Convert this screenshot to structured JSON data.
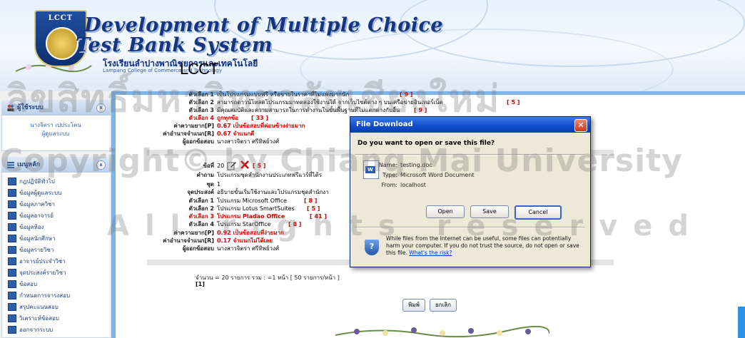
{
  "banner": {
    "logo_text": "LCCT",
    "title_line1": "Development of Multiple Choice",
    "title_line2": "Test Bank System",
    "college_thai": "โรงเรียนลำปางพาณิชยการและเทคโนโลยี",
    "college_english": "Lampang College of Commerce and Technology",
    "college_abbr": "LCCT"
  },
  "sidebar": {
    "user_panel": {
      "title": "ผู้ใช้ระบบ",
      "user_name": "นางจิตรา เปประโคน",
      "user_role": "ผู้ดูแลระบบ"
    },
    "menu_panel": {
      "title": "เมนูหลัก",
      "items": [
        {
          "label": "กฎปฏิบัติทั่วไป"
        },
        {
          "label": "ข้อมูลผู้ดูแลระบบ"
        },
        {
          "label": "ข้อมูลภาควิชา"
        },
        {
          "label": "ข้อมูลอาจารย์"
        },
        {
          "label": "ข้อมูลห้อง"
        },
        {
          "label": "ข้อมูลนักศึกษา"
        },
        {
          "label": "ข้อมูลรายวิชา"
        },
        {
          "label": "อาจารย์ประจำวิชา"
        },
        {
          "label": "จุดประสงค์รายวิชา"
        },
        {
          "label": "ข้อสอบ"
        },
        {
          "label": "กำหนดการจารงสอบ"
        },
        {
          "label": "สรุปคะแนนสอบ"
        },
        {
          "label": "วิเคราะห์ข้อสอบ"
        },
        {
          "label": "ออกจากระบบ"
        }
      ]
    }
  },
  "question19": {
    "rows": [
      {
        "label": "ตัวเลือก 1",
        "value": "เป็นโปรแกรมแบบฟรี หรือขายในราคาที่ไม่แพงมากนัก",
        "count": "[ 9 ]",
        "red": false
      },
      {
        "label": "ตัวเลือก 2",
        "value": "สามารถดาวน์โหลดโปรแกรมมาทดลองใช้งานได้ จากเว็บไซต์ต่าง ๆ บนเครือข่ายอินเทอร์เน็ต",
        "count": "[ 5 ]",
        "red": false
      },
      {
        "label": "ตัวเลือก 3",
        "value": "มีคุณสมบัติและความสามารถในการทำงานในขั้นพื้นฐานที่ไม่แตกต่างกับอื่น",
        "count": "[ 9 ]",
        "red": false
      },
      {
        "label": "ตัวเลือก 4",
        "value": "ถูกทุกข้อ",
        "count": "[ 33 ]",
        "red": true
      }
    ],
    "difficulty_label": "ค่าความยาก[P]",
    "difficulty_value": "0.67  เป็นข้อสอบที่ค่อนข้างง่ายมาก",
    "discrimination_label": "ค่าอำนาจจำแนก[R]",
    "discrimination_value": "0.67  จำแนกดี",
    "author_label": "ผู้ออกข้อสอบ",
    "author_value": "นางสาวจิตรา ศรีทิพย์วงศ์"
  },
  "question20": {
    "number_label": "ข้อที่",
    "number": "20",
    "delete_count": "[ 5 ]",
    "question_label": "คำถาม",
    "question_value": "โปรแกรมชุดสำนักงานประเภทฟรีแวร์ที่ได้ร",
    "set_label": "ชุด",
    "set_value": "1",
    "objective_label": "จุดประสงค์",
    "objective_value": "อธิบายขั้นเริ่มใช้งานและโปรแกรมชุดสำนักงา",
    "rows": [
      {
        "label": "ตัวเลือก 1",
        "value": "โปรแกรม Microsoft Office",
        "count": "[ 8 ]",
        "red": false
      },
      {
        "label": "ตัวเลือก 2",
        "value": "โปรแกรม Lotus SmartSuites",
        "count": "[ 5 ]",
        "red": false
      },
      {
        "label": "ตัวเลือก 3",
        "value": "โปรแกรม Pladao Office",
        "count": "[ 41 ]",
        "red": true
      },
      {
        "label": "ตัวเลือก 4",
        "value": "โปรแกรม StarOffice",
        "count": "[ 8 ]",
        "red": false
      }
    ],
    "difficulty_label": "ค่าความยาก[P]",
    "difficulty_value": "0.92  เป็นข้อสอบที่ง่ายมาก",
    "discrimination_label": "ค่าอำนาจจำแนก[R]",
    "discrimination_value": "0.17  จำแนกไม่ได้เลย",
    "author_label": "ผู้ออกข้อสอบ",
    "author_value": "นางสาวจิตรา ศรีทิพย์วงศ์"
  },
  "pagination": {
    "info": "จำนวน = 20 รายการ รวม : =1 หน้า [ 50 รายการ/หน้า ]",
    "page": "[1]"
  },
  "actions": {
    "print_label": "พิมพ์",
    "cancel_label": "ยกเลิก"
  },
  "dialog": {
    "title": "File Download",
    "question": "Do you want to open or save this file?",
    "name_label": "Name:",
    "name_value": "testing.doc",
    "type_label": "Type:",
    "type_value": "Microsoft Word Document",
    "from_label": "From:",
    "from_value": "localhost",
    "open_label": "Open",
    "save_label": "Save",
    "cancel_label": "Cancel",
    "warning": "While files from the Internet can be useful, some files can potentially harm your computer. If you do not trust the source, do not open or save this file.",
    "risk_link": "What's the risk?"
  },
  "watermark": {
    "line1": "ลิขสิทธิ์มหาวิทยาลัยเชียงใหม่",
    "line2": "Copyright© by Chiang Mai University",
    "line3": "All rights reserved"
  }
}
